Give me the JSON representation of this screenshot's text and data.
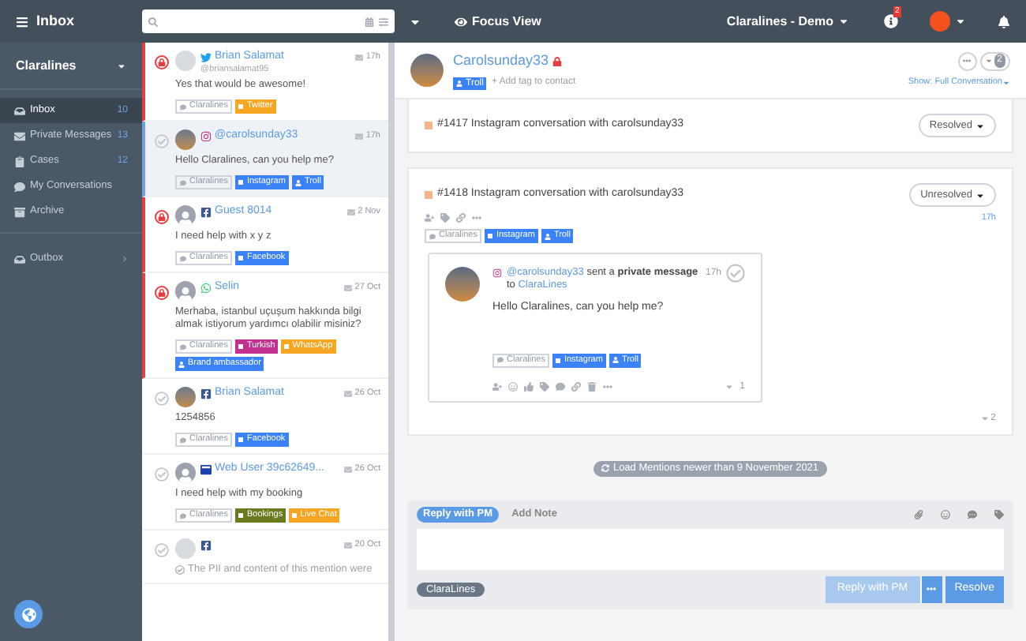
{
  "topbar": {
    "title": "Inbox",
    "focus_view": "Focus View",
    "account": "Claralines - Demo",
    "notification_count": "2"
  },
  "sidebar": {
    "account": "Claralines",
    "items": [
      {
        "label": "Inbox",
        "count": "10",
        "selected": true,
        "kind": "inbox"
      },
      {
        "label": "Private Messages",
        "count": "13",
        "selected": false,
        "kind": "mail"
      },
      {
        "label": "Cases",
        "count": "12",
        "selected": false,
        "kind": "case"
      },
      {
        "label": "My Conversations",
        "selected": false,
        "kind": "chat"
      },
      {
        "label": "Archive",
        "selected": false,
        "kind": "archive"
      }
    ],
    "outbox": "Outbox"
  },
  "conversations": [
    {
      "name": "Brian Salamat",
      "handle": "@briansalamat95",
      "kind": "twitter",
      "avatar": {
        "kind": "blank"
      },
      "text": "Yes that would be awesome!",
      "time": "17h",
      "urgent": true,
      "selected": false,
      "tags": [
        {
          "label": "Claralines",
          "kind": "brand"
        },
        {
          "label": "Twitter",
          "kind": "tag",
          "color": "#f5a623"
        }
      ]
    },
    {
      "name": "@carolsunday33",
      "kind": "instagram",
      "avatar": {
        "kind": "photo"
      },
      "text": "Hello Claralines, can you help me?",
      "time": "17h",
      "urgent": false,
      "selected": true,
      "tags": [
        {
          "label": "Claralines",
          "kind": "brand"
        },
        {
          "label": "Instagram",
          "kind": "tag",
          "color": "#3b82f6"
        },
        {
          "label": "Troll",
          "kind": "user",
          "color": "#3b82f6"
        }
      ]
    },
    {
      "name": "Guest 8014",
      "kind": "facebook",
      "avatar": {
        "kind": "silhouette"
      },
      "text": "I need help with x y z",
      "time": "2 Nov",
      "urgent": true,
      "selected": false,
      "tags": [
        {
          "label": "Claralines",
          "kind": "brand"
        },
        {
          "label": "Facebook",
          "kind": "tag",
          "color": "#3b82f6"
        }
      ]
    },
    {
      "name": "Selin",
      "kind": "whatsapp",
      "avatar": {
        "kind": "silhouette"
      },
      "text": "Merhaba, istanbul uçuşum hakkında bilgi almak istiyorum yardımcı olabilir misiniz?",
      "time": "27 Oct",
      "urgent": true,
      "selected": false,
      "tags": [
        {
          "label": "Claralines",
          "kind": "brand"
        },
        {
          "label": "Turkish",
          "kind": "tag",
          "color": "#c2318f"
        },
        {
          "label": "WhatsApp",
          "kind": "tag",
          "color": "#f5a623"
        },
        {
          "label": "Brand ambassador",
          "kind": "user",
          "color": "#3b82f6"
        }
      ]
    },
    {
      "name": "Brian Salamat",
      "kind": "facebook",
      "avatar": {
        "kind": "photo"
      },
      "text": "1254856",
      "time": "26 Oct",
      "urgent": false,
      "selected": false,
      "tags": [
        {
          "label": "Claralines",
          "kind": "brand"
        },
        {
          "label": "Facebook",
          "kind": "tag",
          "color": "#3b82f6"
        }
      ]
    },
    {
      "name": "Web User 39c62649...",
      "kind": "web",
      "avatar": {
        "kind": "silhouette"
      },
      "text": "I need help with my booking",
      "time": "26 Oct",
      "urgent": false,
      "selected": false,
      "tags": [
        {
          "label": "Claralines",
          "kind": "brand"
        },
        {
          "label": "Bookings",
          "kind": "tag",
          "color": "#6b7a1f"
        },
        {
          "label": "Live Chat",
          "kind": "tag",
          "color": "#f5a623"
        }
      ]
    },
    {
      "kind": "facebook",
      "avatar": {
        "kind": "blank"
      },
      "text": "The PII and content of this mention were",
      "time": "20 Oct",
      "urgent": false,
      "selected": false,
      "removed": true
    }
  ],
  "detail": {
    "name": "Carolsunday33",
    "tag": "Troll",
    "add_tag": "+ Add tag to contact",
    "show": "Show: Full Conversation",
    "count": "2",
    "cases": [
      {
        "number": "#1417",
        "title": "Instagram conversation with carolsunday33",
        "status": "Resolved"
      },
      {
        "number": "#1418",
        "title": "Instagram conversation with carolsunday33",
        "status": "Unresolved",
        "time": "17h",
        "tags": [
          {
            "label": "Claralines",
            "kind": "brand"
          },
          {
            "label": "Instagram",
            "kind": "tag",
            "color": "#3b82f6"
          },
          {
            "label": "Troll",
            "kind": "user",
            "color": "#3b82f6"
          }
        ],
        "message": {
          "sender": "@carolsunday33",
          "action": "sent a **private message** to",
          "recipient": "ClaraLines",
          "time": "17h",
          "text": "Hello Claralines, can you help me?",
          "likes": "1",
          "tags": [
            {
              "label": "Claralines",
              "kind": "brand"
            },
            {
              "label": "Instagram",
              "kind": "tag",
              "color": "#3b82f6"
            },
            {
              "label": "Troll",
              "kind": "user",
              "color": "#3b82f6"
            }
          ]
        },
        "replies": "2"
      }
    ],
    "load_more": "Load Mentions newer than 9 November 2021",
    "composer": {
      "tabs": [
        {
          "label": "Reply with PM",
          "selected": true
        },
        {
          "label": "Add Note",
          "selected": false
        }
      ],
      "sender": "ClaraLines",
      "reply_button": "Reply with PM",
      "reply_disabled": true,
      "resolve_button": "Resolve"
    }
  }
}
